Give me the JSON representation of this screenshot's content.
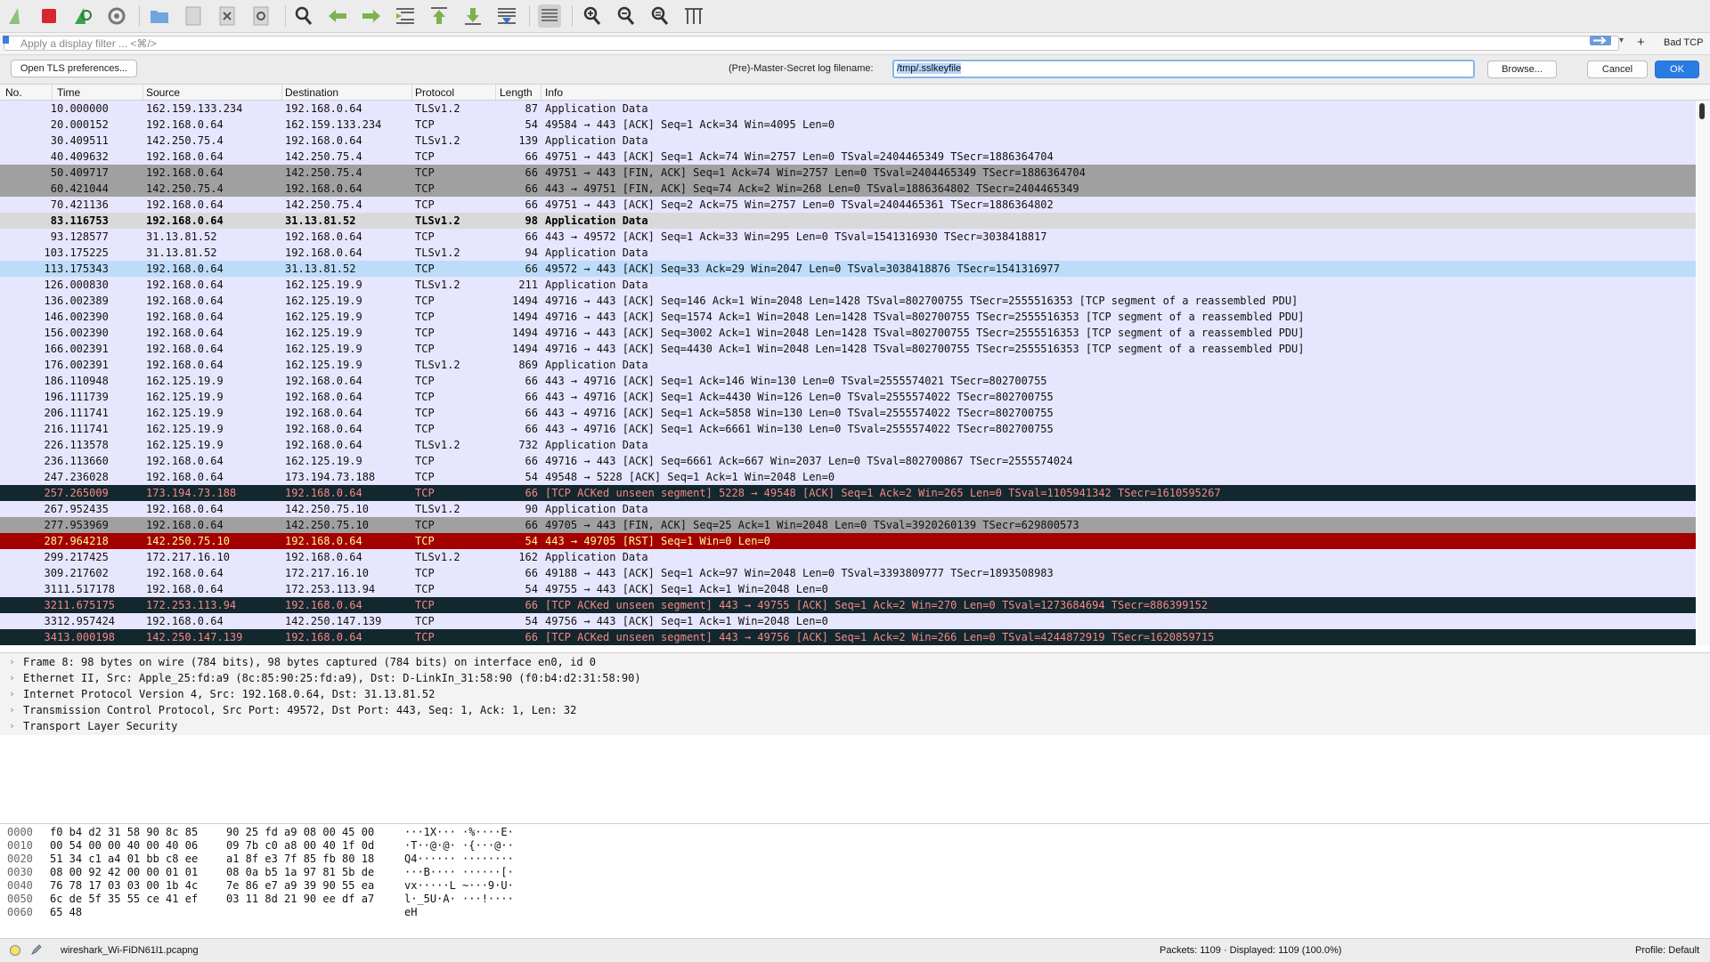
{
  "toolbar": {
    "icons": [
      "shark-fin-start-icon",
      "stop-capture-icon",
      "restart-capture-icon",
      "capture-options-icon",
      "open-file-icon",
      "save-file-icon",
      "close-file-icon",
      "reload-file-icon",
      "find-packet-icon",
      "go-back-icon",
      "go-forward-icon",
      "go-to-packet-icon",
      "first-packet-icon",
      "last-packet-icon",
      "auto-scroll-icon",
      "colorize-icon",
      "zoom-in-icon",
      "zoom-out-icon",
      "zoom-normal-icon",
      "resize-columns-icon"
    ]
  },
  "filter": {
    "placeholder": "Apply a display filter ... <⌘/>",
    "add_button": "+",
    "bad_tcp": "Bad TCP"
  },
  "tls": {
    "open_prefs": "Open TLS preferences...",
    "label": "(Pre)-Master-Secret log filename:",
    "value": "/tmp/.sslkeyfile",
    "browse": "Browse...",
    "cancel": "Cancel",
    "ok": "OK"
  },
  "columns": {
    "no": "No.",
    "time": "Time",
    "source": "Source",
    "destination": "Destination",
    "protocol": "Protocol",
    "length": "Length",
    "info": "Info"
  },
  "colors": {
    "tcp": "#e7e6ff",
    "tls": "#e7e6ff",
    "fin": "#a0a0a0",
    "selected_gray": "#d9d9d9",
    "related": "#bcdcf9",
    "bad": "#12272e",
    "bad_text": "#f78787",
    "rst": "#a40000",
    "rst_text": "#fffc9c"
  },
  "packets": [
    {
      "no": "1",
      "time": "0.000000",
      "src": "162.159.133.234",
      "dst": "192.168.0.64",
      "proto": "TLSv1.2",
      "len": "87",
      "info": "Application Data",
      "style": "tcp"
    },
    {
      "no": "2",
      "time": "0.000152",
      "src": "192.168.0.64",
      "dst": "162.159.133.234",
      "proto": "TCP",
      "len": "54",
      "info": "49584 → 443 [ACK] Seq=1 Ack=34 Win=4095 Len=0",
      "style": "tcp"
    },
    {
      "no": "3",
      "time": "0.409511",
      "src": "142.250.75.4",
      "dst": "192.168.0.64",
      "proto": "TLSv1.2",
      "len": "139",
      "info": "Application Data",
      "style": "tcp"
    },
    {
      "no": "4",
      "time": "0.409632",
      "src": "192.168.0.64",
      "dst": "142.250.75.4",
      "proto": "TCP",
      "len": "66",
      "info": "49751 → 443 [ACK] Seq=1 Ack=74 Win=2757 Len=0 TSval=2404465349 TSecr=1886364704",
      "style": "tcp"
    },
    {
      "no": "5",
      "time": "0.409717",
      "src": "192.168.0.64",
      "dst": "142.250.75.4",
      "proto": "TCP",
      "len": "66",
      "info": "49751 → 443 [FIN, ACK] Seq=1 Ack=74 Win=2757 Len=0 TSval=2404465349 TSecr=1886364704",
      "style": "fin"
    },
    {
      "no": "6",
      "time": "0.421044",
      "src": "142.250.75.4",
      "dst": "192.168.0.64",
      "proto": "TCP",
      "len": "66",
      "info": "443 → 49751 [FIN, ACK] Seq=74 Ack=2 Win=268 Len=0 TSval=1886364802 TSecr=2404465349",
      "style": "fin"
    },
    {
      "no": "7",
      "time": "0.421136",
      "src": "192.168.0.64",
      "dst": "142.250.75.4",
      "proto": "TCP",
      "len": "66",
      "info": "49751 → 443 [ACK] Seq=2 Ack=75 Win=2757 Len=0 TSval=2404465361 TSecr=1886364802",
      "style": "tcp"
    },
    {
      "no": "8",
      "time": "3.116753",
      "src": "192.168.0.64",
      "dst": "31.13.81.52",
      "proto": "TLSv1.2",
      "len": "98",
      "info": "Application Data",
      "style": "selected"
    },
    {
      "no": "9",
      "time": "3.128577",
      "src": "31.13.81.52",
      "dst": "192.168.0.64",
      "proto": "TCP",
      "len": "66",
      "info": "443 → 49572 [ACK] Seq=1 Ack=33 Win=295 Len=0 TSval=1541316930 TSecr=3038418817",
      "style": "tcp"
    },
    {
      "no": "10",
      "time": "3.175225",
      "src": "31.13.81.52",
      "dst": "192.168.0.64",
      "proto": "TLSv1.2",
      "len": "94",
      "info": "Application Data",
      "style": "tcp"
    },
    {
      "no": "11",
      "time": "3.175343",
      "src": "192.168.0.64",
      "dst": "31.13.81.52",
      "proto": "TCP",
      "len": "66",
      "info": "49572 → 443 [ACK] Seq=33 Ack=29 Win=2047 Len=0 TSval=3038418876 TSecr=1541316977",
      "style": "related"
    },
    {
      "no": "12",
      "time": "6.000830",
      "src": "192.168.0.64",
      "dst": "162.125.19.9",
      "proto": "TLSv1.2",
      "len": "211",
      "info": "Application Data",
      "style": "tcp"
    },
    {
      "no": "13",
      "time": "6.002389",
      "src": "192.168.0.64",
      "dst": "162.125.19.9",
      "proto": "TCP",
      "len": "1494",
      "info": "49716 → 443 [ACK] Seq=146 Ack=1 Win=2048 Len=1428 TSval=802700755 TSecr=2555516353 [TCP segment of a reassembled PDU]",
      "style": "tcp"
    },
    {
      "no": "14",
      "time": "6.002390",
      "src": "192.168.0.64",
      "dst": "162.125.19.9",
      "proto": "TCP",
      "len": "1494",
      "info": "49716 → 443 [ACK] Seq=1574 Ack=1 Win=2048 Len=1428 TSval=802700755 TSecr=2555516353 [TCP segment of a reassembled PDU]",
      "style": "tcp"
    },
    {
      "no": "15",
      "time": "6.002390",
      "src": "192.168.0.64",
      "dst": "162.125.19.9",
      "proto": "TCP",
      "len": "1494",
      "info": "49716 → 443 [ACK] Seq=3002 Ack=1 Win=2048 Len=1428 TSval=802700755 TSecr=2555516353 [TCP segment of a reassembled PDU]",
      "style": "tcp"
    },
    {
      "no": "16",
      "time": "6.002391",
      "src": "192.168.0.64",
      "dst": "162.125.19.9",
      "proto": "TCP",
      "len": "1494",
      "info": "49716 → 443 [ACK] Seq=4430 Ack=1 Win=2048 Len=1428 TSval=802700755 TSecr=2555516353 [TCP segment of a reassembled PDU]",
      "style": "tcp"
    },
    {
      "no": "17",
      "time": "6.002391",
      "src": "192.168.0.64",
      "dst": "162.125.19.9",
      "proto": "TLSv1.2",
      "len": "869",
      "info": "Application Data",
      "style": "tcp"
    },
    {
      "no": "18",
      "time": "6.110948",
      "src": "162.125.19.9",
      "dst": "192.168.0.64",
      "proto": "TCP",
      "len": "66",
      "info": "443 → 49716 [ACK] Seq=1 Ack=146 Win=130 Len=0 TSval=2555574021 TSecr=802700755",
      "style": "tcp"
    },
    {
      "no": "19",
      "time": "6.111739",
      "src": "162.125.19.9",
      "dst": "192.168.0.64",
      "proto": "TCP",
      "len": "66",
      "info": "443 → 49716 [ACK] Seq=1 Ack=4430 Win=126 Len=0 TSval=2555574022 TSecr=802700755",
      "style": "tcp"
    },
    {
      "no": "20",
      "time": "6.111741",
      "src": "162.125.19.9",
      "dst": "192.168.0.64",
      "proto": "TCP",
      "len": "66",
      "info": "443 → 49716 [ACK] Seq=1 Ack=5858 Win=130 Len=0 TSval=2555574022 TSecr=802700755",
      "style": "tcp"
    },
    {
      "no": "21",
      "time": "6.111741",
      "src": "162.125.19.9",
      "dst": "192.168.0.64",
      "proto": "TCP",
      "len": "66",
      "info": "443 → 49716 [ACK] Seq=1 Ack=6661 Win=130 Len=0 TSval=2555574022 TSecr=802700755",
      "style": "tcp"
    },
    {
      "no": "22",
      "time": "6.113578",
      "src": "162.125.19.9",
      "dst": "192.168.0.64",
      "proto": "TLSv1.2",
      "len": "732",
      "info": "Application Data",
      "style": "tcp"
    },
    {
      "no": "23",
      "time": "6.113660",
      "src": "192.168.0.64",
      "dst": "162.125.19.9",
      "proto": "TCP",
      "len": "66",
      "info": "49716 → 443 [ACK] Seq=6661 Ack=667 Win=2037 Len=0 TSval=802700867 TSecr=2555574024",
      "style": "tcp"
    },
    {
      "no": "24",
      "time": "7.236028",
      "src": "192.168.0.64",
      "dst": "173.194.73.188",
      "proto": "TCP",
      "len": "54",
      "info": "49548 → 5228 [ACK] Seq=1 Ack=1 Win=2048 Len=0",
      "style": "tcp"
    },
    {
      "no": "25",
      "time": "7.265009",
      "src": "173.194.73.188",
      "dst": "192.168.0.64",
      "proto": "TCP",
      "len": "66",
      "info": "[TCP ACKed unseen segment] 5228 → 49548 [ACK] Seq=1 Ack=2 Win=265 Len=0 TSval=1105941342 TSecr=1610595267",
      "style": "bad"
    },
    {
      "no": "26",
      "time": "7.952435",
      "src": "192.168.0.64",
      "dst": "142.250.75.10",
      "proto": "TLSv1.2",
      "len": "90",
      "info": "Application Data",
      "style": "tcp"
    },
    {
      "no": "27",
      "time": "7.953969",
      "src": "192.168.0.64",
      "dst": "142.250.75.10",
      "proto": "TCP",
      "len": "66",
      "info": "49705 → 443 [FIN, ACK] Seq=25 Ack=1 Win=2048 Len=0 TSval=3920260139 TSecr=629800573",
      "style": "fin"
    },
    {
      "no": "28",
      "time": "7.964218",
      "src": "142.250.75.10",
      "dst": "192.168.0.64",
      "proto": "TCP",
      "len": "54",
      "info": "443 → 49705 [RST] Seq=1 Win=0 Len=0",
      "style": "rst"
    },
    {
      "no": "29",
      "time": "9.217425",
      "src": "172.217.16.10",
      "dst": "192.168.0.64",
      "proto": "TLSv1.2",
      "len": "162",
      "info": "Application Data",
      "style": "tcp"
    },
    {
      "no": "30",
      "time": "9.217602",
      "src": "192.168.0.64",
      "dst": "172.217.16.10",
      "proto": "TCP",
      "len": "66",
      "info": "49188 → 443 [ACK] Seq=1 Ack=97 Win=2048 Len=0 TSval=3393809777 TSecr=1893508983",
      "style": "tcp"
    },
    {
      "no": "31",
      "time": "11.517178",
      "src": "192.168.0.64",
      "dst": "172.253.113.94",
      "proto": "TCP",
      "len": "54",
      "info": "49755 → 443 [ACK] Seq=1 Ack=1 Win=2048 Len=0",
      "style": "tcp"
    },
    {
      "no": "32",
      "time": "11.675175",
      "src": "172.253.113.94",
      "dst": "192.168.0.64",
      "proto": "TCP",
      "len": "66",
      "info": "[TCP ACKed unseen segment] 443 → 49755 [ACK] Seq=1 Ack=2 Win=270 Len=0 TSval=1273684694 TSecr=886399152",
      "style": "bad"
    },
    {
      "no": "33",
      "time": "12.957424",
      "src": "192.168.0.64",
      "dst": "142.250.147.139",
      "proto": "TCP",
      "len": "54",
      "info": "49756 → 443 [ACK] Seq=1 Ack=1 Win=2048 Len=0",
      "style": "tcp"
    },
    {
      "no": "34",
      "time": "13.000198",
      "src": "142.250.147.139",
      "dst": "192.168.0.64",
      "proto": "TCP",
      "len": "66",
      "info": "[TCP ACKed unseen segment] 443 → 49756 [ACK] Seq=1 Ack=2 Win=266 Len=0 TSval=4244872919 TSecr=1620859715",
      "style": "bad"
    }
  ],
  "details": [
    "Frame 8: 98 bytes on wire (784 bits), 98 bytes captured (784 bits) on interface en0, id 0",
    "Ethernet II, Src: Apple_25:fd:a9 (8c:85:90:25:fd:a9), Dst: D-LinkIn_31:58:90 (f0:b4:d2:31:58:90)",
    "Internet Protocol Version 4, Src: 192.168.0.64, Dst: 31.13.81.52",
    "Transmission Control Protocol, Src Port: 49572, Dst Port: 443, Seq: 1, Ack: 1, Len: 32",
    "Transport Layer Security"
  ],
  "bytes": [
    {
      "off": "0000",
      "h1": "f0 b4 d2 31 58 90 8c 85",
      "h2": "90 25 fd a9 08 00 45 00",
      "asc": "···1X··· ·%····E·"
    },
    {
      "off": "0010",
      "h1": "00 54 00 00 40 00 40 06",
      "h2": "09 7b c0 a8 00 40 1f 0d",
      "asc": "·T··@·@· ·{···@··"
    },
    {
      "off": "0020",
      "h1": "51 34 c1 a4 01 bb c8 ee",
      "h2": "a1 8f e3 7f 85 fb 80 18",
      "asc": "Q4······ ········"
    },
    {
      "off": "0030",
      "h1": "08 00 92 42 00 00 01 01",
      "h2": "08 0a b5 1a 97 81 5b de",
      "asc": "···B···· ······[·"
    },
    {
      "off": "0040",
      "h1": "76 78 17 03 03 00 1b 4c",
      "h2": "7e 86 e7 a9 39 90 55 ea",
      "asc": "vx·····L ~···9·U·"
    },
    {
      "off": "0050",
      "h1": "6c de 5f 35 55 ce 41 ef",
      "h2": "03 11 8d 21 90 ee df a7",
      "asc": "l·_5U·A· ···!····"
    },
    {
      "off": "0060",
      "h1": "65 48",
      "h2": "",
      "asc": "eH"
    }
  ],
  "status": {
    "file": "wireshark_Wi-FiDN61l1.pcapng",
    "packets": "Packets: 1109 · Displayed: 1109 (100.0%)",
    "profile": "Profile: Default"
  }
}
